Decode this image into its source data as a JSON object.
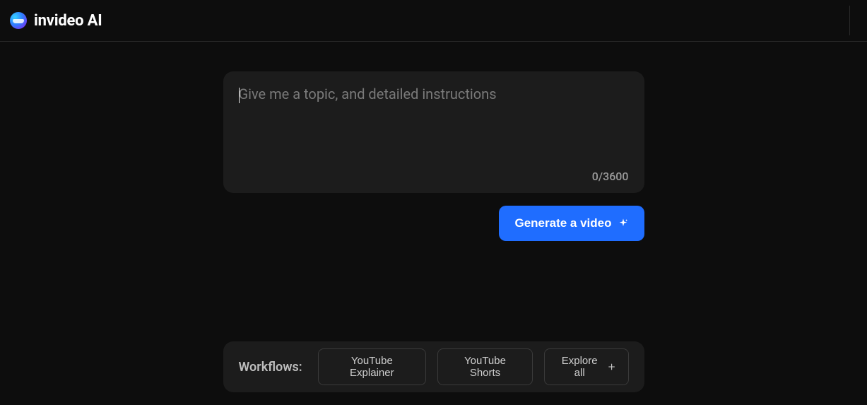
{
  "header": {
    "brand": "invideo AI"
  },
  "prompt": {
    "placeholder": "Give me a topic, and detailed instructions",
    "value": "",
    "counter": "0/3600"
  },
  "actions": {
    "generate_label": "Generate a video"
  },
  "workflows": {
    "label": "Workflows:",
    "items": [
      {
        "label": "YouTube Explainer"
      },
      {
        "label": "YouTube Shorts"
      }
    ],
    "explore_label": "Explore all"
  }
}
